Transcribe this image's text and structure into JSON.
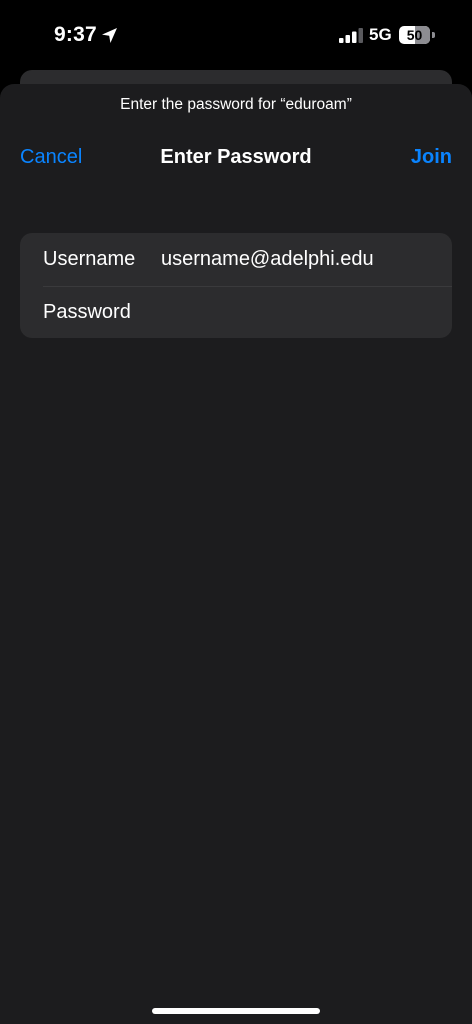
{
  "status_bar": {
    "time": "9:37",
    "network_type": "5G",
    "battery_level": "50",
    "battery_percent": 50,
    "location_icon": "location-arrow-icon",
    "signal_icon": "cellular-signal-icon",
    "signal_bars_active": 3,
    "signal_bars_total": 4
  },
  "sheet": {
    "prompt": "Enter the password for “eduroam”",
    "title": "Enter Password",
    "cancel_label": "Cancel",
    "join_label": "Join"
  },
  "form": {
    "username_label": "Username",
    "username_value": "username@adelphi.edu",
    "password_label": "Password",
    "password_value": ""
  },
  "colors": {
    "accent": "#0a84ff",
    "sheet_background": "#1c1c1e",
    "group_background": "#2c2c2e"
  }
}
